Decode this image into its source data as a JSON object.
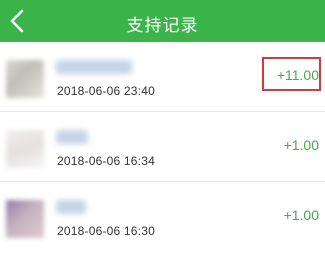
{
  "header": {
    "title": "支持记录",
    "back_icon": "chevron-left-icon",
    "background_color": "#3bb54a"
  },
  "records": [
    {
      "timestamp": "2018-06-06 23:40",
      "amount": "+11.00",
      "highlighted": true
    },
    {
      "timestamp": "2018-06-06 16:34",
      "amount": "+1.00",
      "highlighted": false
    },
    {
      "timestamp": "2018-06-06 16:30",
      "amount": "+1.00",
      "highlighted": false
    }
  ],
  "colors": {
    "amount": "#4aa84a",
    "highlight_border": "#d43a3a",
    "divider": "#e8e8e8"
  }
}
